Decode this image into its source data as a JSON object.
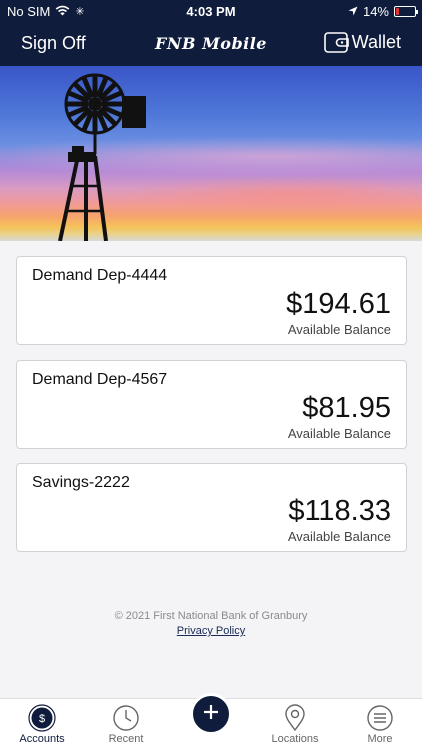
{
  "status_bar": {
    "carrier": "No SIM",
    "time": "4:03 PM",
    "battery_percent": "14%",
    "battery_level": 0.14,
    "battery_color": "#e33333"
  },
  "header": {
    "sign_off_label": "Sign Off",
    "title": "FNB Mobile",
    "wallet_label": "Wallet",
    "background_color": "#0f1c3b"
  },
  "accounts": [
    {
      "name": "Demand Dep-4444",
      "balance": "$194.61",
      "balance_label": "Available Balance"
    },
    {
      "name": "Demand Dep-4567",
      "balance": "$81.95",
      "balance_label": "Available Balance"
    },
    {
      "name": "Savings-2222",
      "balance": "$118.33",
      "balance_label": "Available Balance"
    }
  ],
  "footer": {
    "copyright": "© 2021 First National Bank of Granbury",
    "privacy_link": "Privacy Policy"
  },
  "tab_bar": {
    "items": [
      {
        "label": "Accounts",
        "icon": "dollar-circle-icon",
        "active": true
      },
      {
        "label": "Recent",
        "icon": "clock-icon",
        "active": false
      },
      {
        "label": "",
        "icon": "plus-icon",
        "active": false
      },
      {
        "label": "Locations",
        "icon": "map-pin-icon",
        "active": false
      },
      {
        "label": "More",
        "icon": "menu-icon",
        "active": false
      }
    ]
  }
}
